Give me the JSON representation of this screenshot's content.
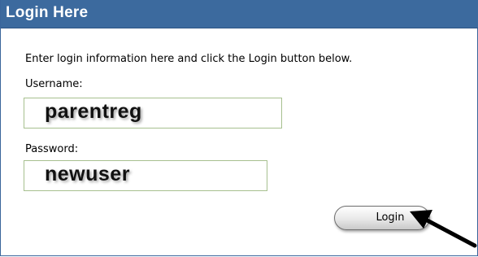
{
  "header": {
    "title": "Login Here"
  },
  "form": {
    "instructions": "Enter login information here and click the Login button below.",
    "username_label": "Username:",
    "username_value": "parentreg",
    "password_label": "Password:",
    "password_value": "newuser",
    "login_label": "Login"
  },
  "colors": {
    "header_bg": "#3c6a9e",
    "field_border": "#a7c08f"
  },
  "icons": {
    "pointer": "arrow-pointer-icon"
  }
}
